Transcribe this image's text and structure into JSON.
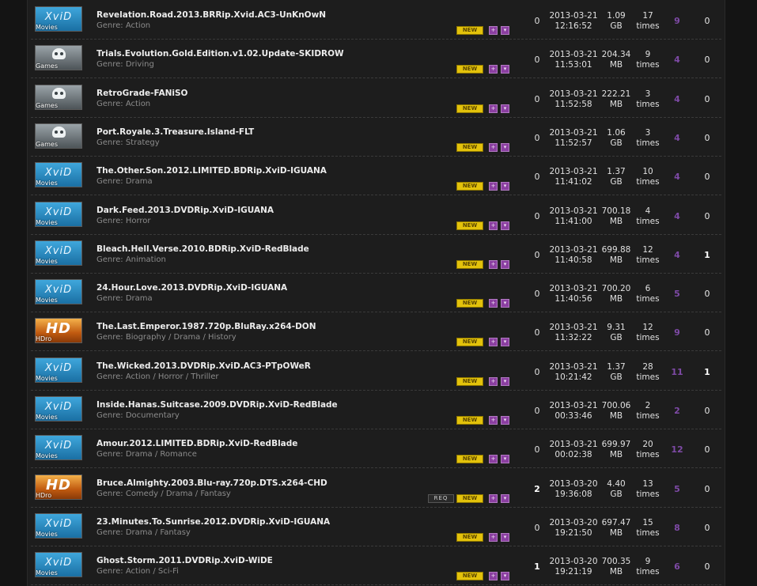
{
  "torrents": [
    {
      "category": "Movies",
      "kind": "movies",
      "logo": "XviD",
      "title": "Revelation.Road.2013.BRRip.Xvid.AC3-UnKnOwN",
      "genre": "Genre: Action",
      "req": false,
      "new_label": "NEW",
      "comments": "0",
      "date": "2013-03-21",
      "time": "12:16:52",
      "size_value": "1.09",
      "size_unit": "GB",
      "snatched_count": "17",
      "snatched_label": "times",
      "seeders": "9",
      "leechers": "0"
    },
    {
      "category": "Games",
      "kind": "games",
      "logo": "",
      "title": "Trials.Evolution.Gold.Edition.v1.02.Update-SKIDROW",
      "genre": "Genre: Driving",
      "req": false,
      "new_label": "NEW",
      "comments": "0",
      "date": "2013-03-21",
      "time": "11:53:01",
      "size_value": "204.34",
      "size_unit": "MB",
      "snatched_count": "9",
      "snatched_label": "times",
      "seeders": "4",
      "leechers": "0"
    },
    {
      "category": "Games",
      "kind": "games",
      "logo": "",
      "title": "RetroGrade-FANiSO",
      "genre": "Genre: Action",
      "req": false,
      "new_label": "NEW",
      "comments": "0",
      "date": "2013-03-21",
      "time": "11:52:58",
      "size_value": "222.21",
      "size_unit": "MB",
      "snatched_count": "3",
      "snatched_label": "times",
      "seeders": "4",
      "leechers": "0"
    },
    {
      "category": "Games",
      "kind": "games",
      "logo": "",
      "title": "Port.Royale.3.Treasure.Island-FLT",
      "genre": "Genre: Strategy",
      "req": false,
      "new_label": "NEW",
      "comments": "0",
      "date": "2013-03-21",
      "time": "11:52:57",
      "size_value": "1.06",
      "size_unit": "GB",
      "snatched_count": "3",
      "snatched_label": "times",
      "seeders": "4",
      "leechers": "0"
    },
    {
      "category": "Movies",
      "kind": "movies",
      "logo": "XviD",
      "title": "The.Other.Son.2012.LIMITED.BDRip.XviD-IGUANA",
      "genre": "Genre: Drama",
      "req": false,
      "new_label": "NEW",
      "comments": "0",
      "date": "2013-03-21",
      "time": "11:41:02",
      "size_value": "1.37",
      "size_unit": "GB",
      "snatched_count": "10",
      "snatched_label": "times",
      "seeders": "4",
      "leechers": "0"
    },
    {
      "category": "Movies",
      "kind": "movies",
      "logo": "XviD",
      "title": "Dark.Feed.2013.DVDRip.XviD-IGUANA",
      "genre": "Genre: Horror",
      "req": false,
      "new_label": "NEW",
      "comments": "0",
      "date": "2013-03-21",
      "time": "11:41:00",
      "size_value": "700.18",
      "size_unit": "MB",
      "snatched_count": "4",
      "snatched_label": "times",
      "seeders": "4",
      "leechers": "0"
    },
    {
      "category": "Movies",
      "kind": "movies",
      "logo": "XviD",
      "title": "Bleach.Hell.Verse.2010.BDRip.XviD-RedBlade",
      "genre": "Genre: Animation",
      "req": false,
      "new_label": "NEW",
      "comments": "0",
      "date": "2013-03-21",
      "time": "11:40:58",
      "size_value": "699.88",
      "size_unit": "MB",
      "snatched_count": "12",
      "snatched_label": "times",
      "seeders": "4",
      "leechers": "1"
    },
    {
      "category": "Movies",
      "kind": "movies",
      "logo": "XviD",
      "title": "24.Hour.Love.2013.DVDRip.XviD-IGUANA",
      "genre": "Genre: Drama",
      "req": false,
      "new_label": "NEW",
      "comments": "0",
      "date": "2013-03-21",
      "time": "11:40:56",
      "size_value": "700.20",
      "size_unit": "MB",
      "snatched_count": "6",
      "snatched_label": "times",
      "seeders": "5",
      "leechers": "0"
    },
    {
      "category": "HDro",
      "kind": "hd",
      "logo": "HD",
      "title": "The.Last.Emperor.1987.720p.BluRay.x264-DON",
      "genre": "Genre: Biography / Drama / History",
      "req": false,
      "new_label": "NEW",
      "comments": "0",
      "date": "2013-03-21",
      "time": "11:32:22",
      "size_value": "9.31",
      "size_unit": "GB",
      "snatched_count": "12",
      "snatched_label": "times",
      "seeders": "9",
      "leechers": "0"
    },
    {
      "category": "Movies",
      "kind": "movies",
      "logo": "XviD",
      "title": "The.Wicked.2013.DVDRip.XviD.AC3-PTpOWeR",
      "genre": "Genre: Action / Horror / Thriller",
      "req": false,
      "new_label": "NEW",
      "comments": "0",
      "date": "2013-03-21",
      "time": "10:21:42",
      "size_value": "1.37",
      "size_unit": "GB",
      "snatched_count": "28",
      "snatched_label": "times",
      "seeders": "11",
      "leechers": "1"
    },
    {
      "category": "Movies",
      "kind": "movies",
      "logo": "XviD",
      "title": "Inside.Hanas.Suitcase.2009.DVDRip.XviD-RedBlade",
      "genre": "Genre: Documentary",
      "req": false,
      "new_label": "NEW",
      "comments": "0",
      "date": "2013-03-21",
      "time": "00:33:46",
      "size_value": "700.06",
      "size_unit": "MB",
      "snatched_count": "2",
      "snatched_label": "times",
      "seeders": "2",
      "leechers": "0"
    },
    {
      "category": "Movies",
      "kind": "movies",
      "logo": "XviD",
      "title": "Amour.2012.LIMITED.BDRip.XviD-RedBlade",
      "genre": "Genre: Drama / Romance",
      "req": false,
      "new_label": "NEW",
      "comments": "0",
      "date": "2013-03-21",
      "time": "00:02:38",
      "size_value": "699.97",
      "size_unit": "MB",
      "snatched_count": "20",
      "snatched_label": "times",
      "seeders": "12",
      "leechers": "0"
    },
    {
      "category": "HDro",
      "kind": "hd",
      "logo": "HD",
      "title": "Bruce.Almighty.2003.Blu-ray.720p.DTS.x264-CHD",
      "genre": "Genre: Comedy / Drama / Fantasy",
      "req": true,
      "req_label": "REQ",
      "new_label": "NEW",
      "comments": "2",
      "date": "2013-03-20",
      "time": "19:36:08",
      "size_value": "4.40",
      "size_unit": "GB",
      "snatched_count": "13",
      "snatched_label": "times",
      "seeders": "5",
      "leechers": "0"
    },
    {
      "category": "Movies",
      "kind": "movies",
      "logo": "XviD",
      "title": "23.Minutes.To.Sunrise.2012.DVDRip.XviD-IGUANA",
      "genre": "Genre: Drama / Fantasy",
      "req": false,
      "new_label": "NEW",
      "comments": "0",
      "date": "2013-03-20",
      "time": "19:21:50",
      "size_value": "697.47",
      "size_unit": "MB",
      "snatched_count": "15",
      "snatched_label": "times",
      "seeders": "8",
      "leechers": "0"
    },
    {
      "category": "Movies",
      "kind": "movies",
      "logo": "XviD",
      "title": "Ghost.Storm.2011.DVDRip.XviD-WiDE",
      "genre": "Genre: Action / Sci-Fi",
      "req": false,
      "new_label": "NEW",
      "comments": "1",
      "date": "2013-03-20",
      "time": "19:21:19",
      "size_value": "700.35",
      "size_unit": "MB",
      "snatched_count": "9",
      "snatched_label": "times",
      "seeders": "6",
      "leechers": "0"
    }
  ]
}
